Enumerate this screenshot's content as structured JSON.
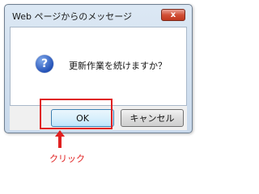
{
  "dialog": {
    "title": "Web ページからのメッセージ",
    "close_glyph": "x",
    "message": "更新作業を続けますか？",
    "icon": "question-icon",
    "ok_label": "OK",
    "cancel_label": "キャンセル"
  },
  "annotation": {
    "label": "クリック",
    "color": "#e02020",
    "icon": "arrow-up-icon"
  }
}
